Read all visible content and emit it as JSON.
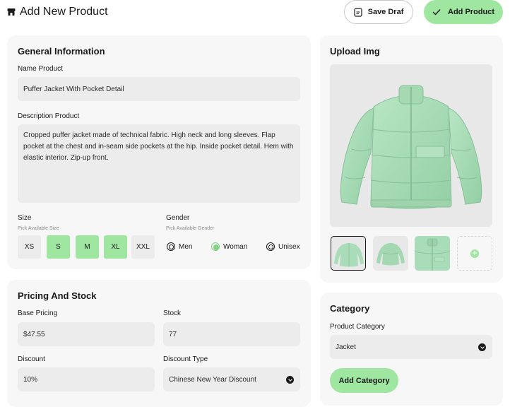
{
  "header": {
    "title": "Add New Product",
    "save_draft_label": "Save Draf",
    "add_product_label": "Add Product"
  },
  "general": {
    "title": "General Information",
    "name_label": "Name Product",
    "name_value": "Puffer Jacket With Pocket Detail",
    "description_label": "Description Product",
    "description_value": "Cropped puffer jacket made of technical fabric. High neck and long sleeves. Flap pocket at the chest and in-seam side pockets at the hip. Inside pocket detail. Hem with elastic interior. Zip-up front.",
    "size_label": "Size",
    "size_hint": "Pick Available Size",
    "sizes": [
      {
        "label": "XS",
        "selected": false
      },
      {
        "label": "S",
        "selected": true
      },
      {
        "label": "M",
        "selected": true
      },
      {
        "label": "XL",
        "selected": true
      },
      {
        "label": "XXL",
        "selected": false
      }
    ],
    "gender_label": "Gender",
    "gender_hint": "Pick Available Gender",
    "genders": [
      {
        "label": "Men",
        "selected": false
      },
      {
        "label": "Woman",
        "selected": true
      },
      {
        "label": "Unisex",
        "selected": false
      }
    ]
  },
  "pricing": {
    "title": "Pricing And Stock",
    "base_label": "Base Pricing",
    "base_value": "$47.55",
    "stock_label": "Stock",
    "stock_value": "77",
    "discount_label": "Discount",
    "discount_value": "10%",
    "discount_type_label": "Discount Type",
    "discount_type_value": "Chinese New Year Discount"
  },
  "upload": {
    "title": "Upload Img"
  },
  "category": {
    "title": "Category",
    "product_category_label": "Product Category",
    "product_category_value": "Jacket",
    "add_category_label": "Add Category"
  },
  "colors": {
    "accent": "#9fe6a0",
    "card_bg": "#f7f7f7",
    "field_bg": "#ececec",
    "jacket": "#a9dcb8"
  },
  "icons": {
    "title_icon": "store-icon",
    "draft_icon": "document-icon",
    "add_icon": "check-icon",
    "select_icon": "chevron-down-icon",
    "add_image_icon": "plus-icon"
  }
}
